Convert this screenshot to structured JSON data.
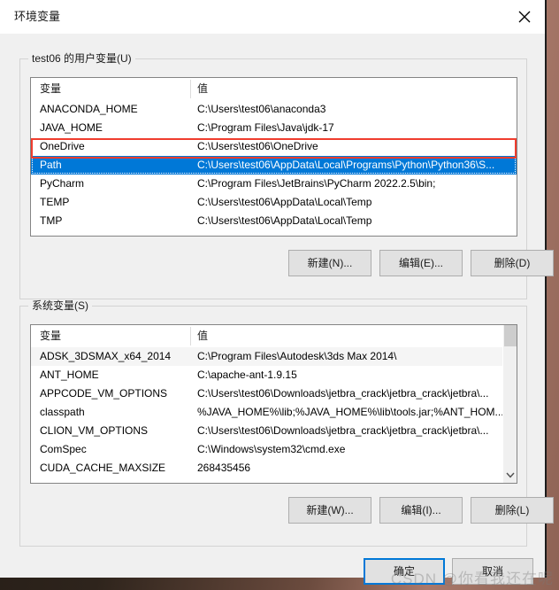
{
  "window": {
    "title": "环境变量",
    "close_icon": "close-icon"
  },
  "user_section": {
    "legend": "test06 的用户变量(U)",
    "columns": [
      "变量",
      "值"
    ],
    "rows": [
      {
        "name": "ANACONDA_HOME",
        "value": "C:\\Users\\test06\\anaconda3"
      },
      {
        "name": "JAVA_HOME",
        "value": "C:\\Program Files\\Java\\jdk-17"
      },
      {
        "name": "OneDrive",
        "value": "C:\\Users\\test06\\OneDrive"
      },
      {
        "name": "Path",
        "value": "C:\\Users\\test06\\AppData\\Local\\Programs\\Python\\Python36\\S..."
      },
      {
        "name": "PyCharm",
        "value": "C:\\Program Files\\JetBrains\\PyCharm 2022.2.5\\bin;"
      },
      {
        "name": "TEMP",
        "value": "C:\\Users\\test06\\AppData\\Local\\Temp"
      },
      {
        "name": "TMP",
        "value": "C:\\Users\\test06\\AppData\\Local\\Temp"
      }
    ],
    "selected_index": 3,
    "buttons": {
      "new": "新建(N)...",
      "edit": "编辑(E)...",
      "delete": "删除(D)"
    }
  },
  "system_section": {
    "legend": "系统变量(S)",
    "columns": [
      "变量",
      "值"
    ],
    "rows": [
      {
        "name": "ADSK_3DSMAX_x64_2014",
        "value": "C:\\Program Files\\Autodesk\\3ds Max 2014\\"
      },
      {
        "name": "ANT_HOME",
        "value": "C:\\apache-ant-1.9.15"
      },
      {
        "name": "APPCODE_VM_OPTIONS",
        "value": "C:\\Users\\test06\\Downloads\\jetbra_crack\\jetbra_crack\\jetbra\\..."
      },
      {
        "name": "classpath",
        "value": "%JAVA_HOME%\\lib;%JAVA_HOME%\\lib\\tools.jar;%ANT_HOM..."
      },
      {
        "name": "CLION_VM_OPTIONS",
        "value": "C:\\Users\\test06\\Downloads\\jetbra_crack\\jetbra_crack\\jetbra\\..."
      },
      {
        "name": "ComSpec",
        "value": "C:\\Windows\\system32\\cmd.exe"
      },
      {
        "name": "CUDA_CACHE_MAXSIZE",
        "value": "268435456"
      }
    ],
    "hover_index": 0,
    "scroll_down_icon": "chevron-down-icon",
    "buttons": {
      "new": "新建(W)...",
      "edit": "编辑(I)...",
      "delete": "删除(L)"
    }
  },
  "dialog_buttons": {
    "ok": "确定",
    "cancel": "取消"
  },
  "annotation": {
    "highlight_color": "#f03d2e",
    "selection_color": "#0078d7"
  },
  "watermark": {
    "text": "CSDN @你看我还在呢"
  }
}
